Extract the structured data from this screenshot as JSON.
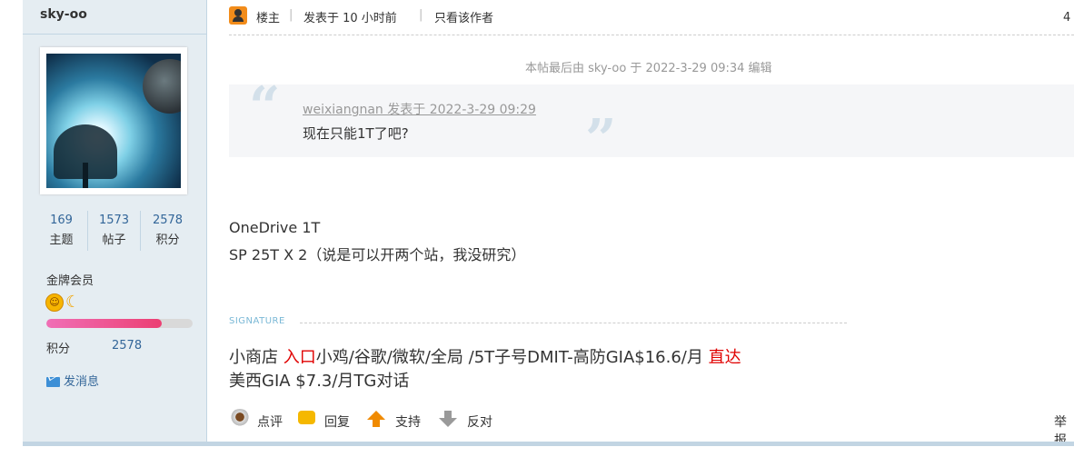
{
  "user": {
    "name": "sky-oo",
    "stats": [
      {
        "value": "169",
        "label": "主题"
      },
      {
        "value": "1573",
        "label": "帖子"
      },
      {
        "value": "2578",
        "label": "积分"
      }
    ],
    "group": "金牌会员",
    "progress": 0.79,
    "points_label": "积分",
    "points_value": "2578",
    "send_message": "发消息"
  },
  "post": {
    "owner_label": "楼主",
    "posted_at": "发表于 10 小时前",
    "only_author": "只看该作者",
    "floor": "4",
    "edit_note": "本帖最后由 sky-oo 于 2022-3-29 09:34 编辑",
    "quote": {
      "author_line": "weixiangnan 发表于 2022-3-29 09:29",
      "text": "现在只能1T了吧?"
    },
    "body": [
      "OneDrive 1T",
      "SP 25T X 2（说是可以开两个站，我没研究）"
    ],
    "signature_label": "SIGNATURE",
    "signature": {
      "line1_a": "小商店 ",
      "line1_link1": "入口",
      "line1_b": "小鸡/谷歌/微软/全局 /5T子号DMIT-高防GIA$16.6/月 ",
      "line1_link2": "直达",
      "line2": "美西GIA $7.3/月TG对话"
    }
  },
  "actions": {
    "comment": "点评",
    "reply": "回复",
    "support": "支持",
    "oppose": "反对",
    "report": "举报"
  },
  "colors": {
    "sidebar_bg": "#e5edf2",
    "link": "#336699",
    "accent_red": "#e00000",
    "progress_fill": "#ec3f73"
  }
}
